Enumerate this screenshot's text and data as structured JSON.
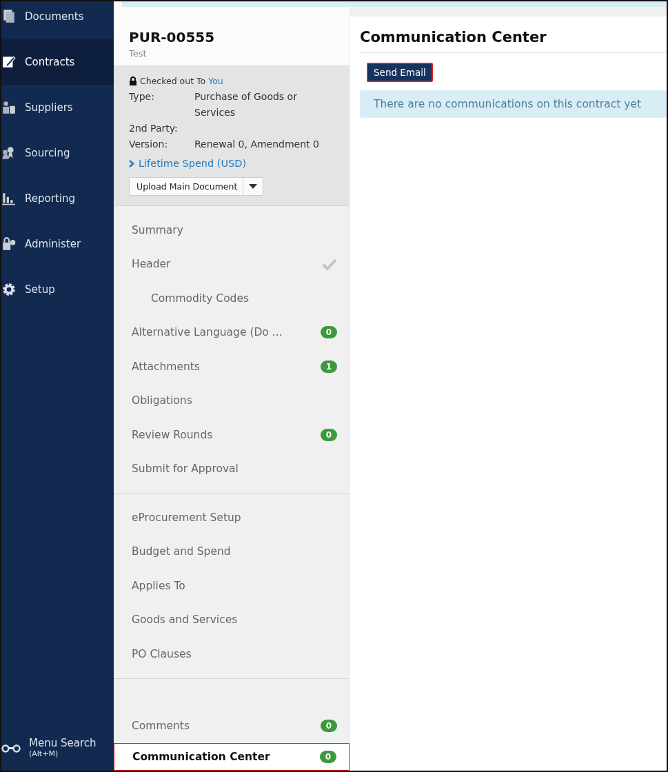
{
  "nav": {
    "items": [
      {
        "label": "Documents",
        "kind": "documents",
        "selected": false
      },
      {
        "label": "Contracts",
        "kind": "contracts",
        "selected": true
      },
      {
        "label": "Suppliers",
        "kind": "suppliers",
        "selected": false
      },
      {
        "label": "Sourcing",
        "kind": "sourcing",
        "selected": false
      },
      {
        "label": "Reporting",
        "kind": "reporting",
        "selected": false
      },
      {
        "label": "Administer",
        "kind": "administer",
        "selected": false
      },
      {
        "label": "Setup",
        "kind": "setup",
        "selected": false
      }
    ],
    "menu_search": {
      "label": "Menu Search",
      "shortcut": "(Alt+M)"
    }
  },
  "contract": {
    "number": "PUR-00555",
    "name": "Test",
    "checkout": {
      "text": "Checked out To",
      "user": "You"
    },
    "fields": [
      {
        "label": "Type:",
        "value": "Purchase of Goods or Services"
      },
      {
        "label": "2nd Party:"
      },
      {
        "label": "Version:",
        "value": "Renewal 0, Amendment 0"
      }
    ],
    "lifetime_spend": "Lifetime Spend (USD)",
    "upload_button": "Upload Main Document"
  },
  "sections": [
    [
      {
        "label": "Summary",
        "selected": false
      },
      {
        "label": "Header",
        "selected": false,
        "done": true,
        "children": [
          {
            "label": "Commodity Codes",
            "selected": false
          }
        ]
      },
      {
        "label": "Alternative Language (Do ...",
        "selected": false,
        "badge": "0"
      },
      {
        "label": "Attachments",
        "selected": false,
        "badge": "1"
      },
      {
        "label": "Obligations",
        "selected": false
      },
      {
        "label": "Review Rounds",
        "selected": false,
        "badge": "0"
      },
      {
        "label": "Submit for Approval",
        "selected": false
      }
    ],
    [
      {
        "label": "eProcurement Setup",
        "selected": false
      },
      {
        "label": "Budget and Spend",
        "selected": false
      },
      {
        "label": "Applies To",
        "selected": false
      },
      {
        "label": "Goods and Services",
        "selected": false
      },
      {
        "label": "PO Clauses",
        "selected": false
      }
    ],
    [
      {
        "label": "Comments",
        "selected": false,
        "badge": "0"
      },
      {
        "label": "Communication Center",
        "selected": true,
        "badge": "0"
      }
    ]
  ],
  "panel": {
    "title": "Communication Center",
    "button": "Send Email",
    "message": "There are no communications on this contract yet"
  }
}
